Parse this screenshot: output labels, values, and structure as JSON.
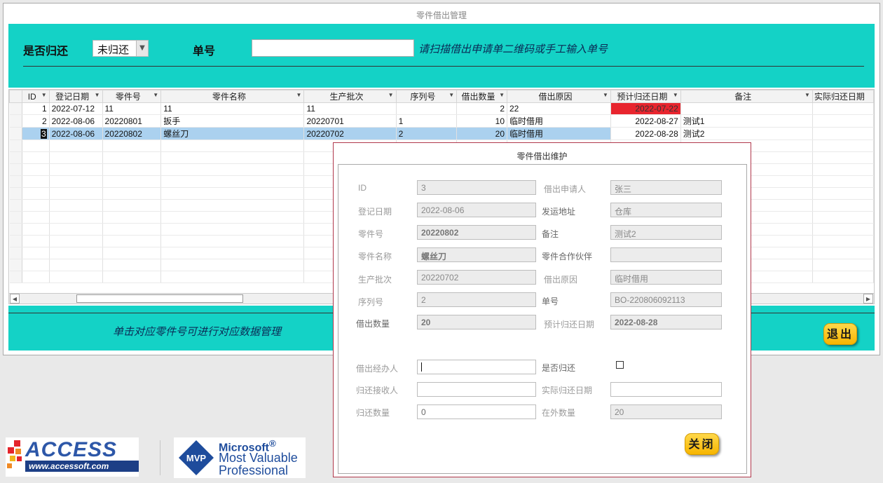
{
  "window": {
    "title": "零件借出管理"
  },
  "header": {
    "returned_label": "是否归还",
    "returned_value": "未归还",
    "order_label": "单号",
    "order_value": "",
    "order_hint": "请扫描借出申请单二维码或手工输入单号"
  },
  "grid": {
    "columns": [
      "ID",
      "登记日期",
      "零件号",
      "零件名称",
      "生产批次",
      "序列号",
      "借出数量",
      "借出原因",
      "预计归还日期",
      "备注",
      "实际归还日期"
    ],
    "rows": [
      {
        "id": "1",
        "reg_date": "2022-07-12",
        "part_no": "11",
        "part_name": "11",
        "batch": "11",
        "serial": "",
        "qty": "2",
        "reason": "22",
        "expected_return": "2022-07-22",
        "remark": "",
        "actual_return": ""
      },
      {
        "id": "2",
        "reg_date": "2022-08-06",
        "part_no": "20220801",
        "part_name": "扳手",
        "batch": "20220701",
        "serial": "1",
        "qty": "10",
        "reason": "临时借用",
        "expected_return": "2022-08-27",
        "remark": "测试1",
        "actual_return": ""
      },
      {
        "id": "3",
        "reg_date": "2022-08-06",
        "part_no": "20220802",
        "part_name": "螺丝刀",
        "batch": "20220702",
        "serial": "2",
        "qty": "20",
        "reason": "临时借用",
        "expected_return": "2022-08-28",
        "remark": "测试2",
        "actual_return": ""
      }
    ],
    "overdue_color": "#e8252e",
    "selected_row_color": "#abd1ef"
  },
  "footer": {
    "hint": "单击对应零件号可进行对应数据管理",
    "exit_label": "退出"
  },
  "dialog": {
    "title": "零件借出维护",
    "id_label": "ID",
    "id_value": "3",
    "applicant_label": "借出申请人",
    "applicant_value": "张三",
    "reg_date_label": "登记日期",
    "reg_date_value": "2022-08-06",
    "ship_addr_label": "发运地址",
    "ship_addr_value": "仓库",
    "part_no_label": "零件号",
    "part_no_value": "20220802",
    "remark_label": "备注",
    "remark_value": "测试2",
    "part_name_label": "零件名称",
    "part_name_value": "螺丝刀",
    "partner_label": "零件合作伙伴",
    "partner_value": "",
    "batch_label": "生产批次",
    "batch_value": "20220702",
    "reason_label": "借出原因",
    "reason_value": "临时借用",
    "serial_label": "序列号",
    "serial_value": "2",
    "order_no_label": "单号",
    "order_no_value": "BO-220806092113",
    "qty_label": "借出数量",
    "qty_value": "20",
    "expected_label": "预计归还日期",
    "expected_value": "2022-08-28",
    "handler_label": "借出经办人",
    "handler_value": "",
    "returned_label": "是否归还",
    "receiver_label": "归还接收人",
    "receiver_value": "",
    "actual_label": "实际归还日期",
    "actual_value": "",
    "return_qty_label": "归还数量",
    "return_qty_value": "0",
    "outstanding_label": "在外数量",
    "outstanding_value": "20",
    "close_label": "关闭"
  },
  "logos": {
    "access_text": "ACCESS",
    "access_url": "www.accessoft.com",
    "mvp_badge": "MVP",
    "mvp_company": "Microsoft",
    "mvp_registered": "®",
    "mvp_line1": "Most Valuable",
    "mvp_line2": "Professional"
  },
  "colors": {
    "accent": "#14d2c6",
    "button_gold": "#f7b500",
    "dialog_border": "#b0374b"
  }
}
